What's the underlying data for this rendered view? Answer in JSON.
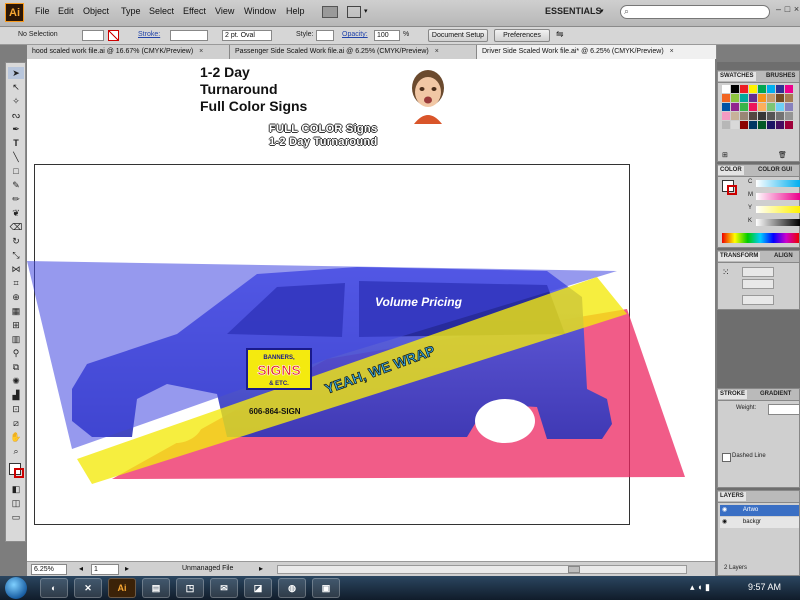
{
  "app": {
    "logo": "Ai"
  },
  "menu": {
    "items": [
      "File",
      "Edit",
      "Object",
      "Type",
      "Select",
      "Effect",
      "View",
      "Window",
      "Help"
    ],
    "workspace": "ESSENTIALS"
  },
  "controlbar": {
    "selection": "No Selection",
    "stroke_label": "Stroke:",
    "brush": "2 pt. Oval",
    "style_label": "Style:",
    "opacity_label": "Opacity:",
    "opacity_value": "100",
    "opacity_unit": "%",
    "document_setup": "Document Setup",
    "preferences": "Preferences"
  },
  "tabs": [
    {
      "label": "hood scaled work file.ai @ 16.67% (CMYK/Preview)",
      "close": "×"
    },
    {
      "label": "Passenger Side Scaled Work file.ai @ 6.25% (CMYK/Preview)",
      "close": "×"
    },
    {
      "label": "Driver Side Scaled Work file.ai* @ 6.25% (CMYK/Preview)",
      "close": "×"
    }
  ],
  "art": {
    "headline": [
      "1-2 Day",
      "Turnaround",
      "Full Color Signs"
    ],
    "outline_text": [
      "FULL COLOR Signs",
      "1-2 Day Turnaround"
    ],
    "volume": "Volume Pricing",
    "wrap": "YEAH, WE WRAP",
    "phone": "606-864-SIGN",
    "logo_lines": [
      "BANNERS,",
      "SIGNS",
      "& ETC."
    ]
  },
  "status": {
    "zoom": "6.25%",
    "page": "1",
    "mode": "Unmanaged File"
  },
  "panels": {
    "swatches": {
      "tabs": [
        "SWATCHES",
        "BRUSHES"
      ]
    },
    "color": {
      "tabs": [
        "COLOR",
        "COLOR GUI"
      ],
      "channels": [
        "C",
        "M",
        "Y",
        "K"
      ]
    },
    "transform": {
      "tabs": [
        "TRANSFORM",
        "ALIGN"
      ]
    },
    "stroke": {
      "tabs": [
        "STROKE",
        "GRADIENT"
      ],
      "weight_label": "Weight:",
      "dashed": "Dashed Line"
    },
    "layers": {
      "tab": "LAYERS",
      "rows": [
        "Artwo",
        "backgr"
      ],
      "footer": "2 Layers"
    }
  },
  "taskbar": {
    "clock": "9:57 AM",
    "ai_label": "Ai"
  },
  "colors": {
    "blue": "#3f45e0",
    "yellow": "#f4ea0f",
    "red": "#ec2560",
    "swatches": [
      "#ffffff",
      "#000000",
      "#ed1c24",
      "#fff200",
      "#00a651",
      "#00aeef",
      "#2e3192",
      "#ec008c",
      "#f26522",
      "#8dc63f",
      "#00a99d",
      "#662d91",
      "#f7941d",
      "#c69c6d",
      "#754c24",
      "#a67c52",
      "#0054a6",
      "#92278f",
      "#39b54a",
      "#ed145b",
      "#fbaf5d",
      "#7cc576",
      "#6dcff6",
      "#8781bd",
      "#f49ac2",
      "#c7b299",
      "#998675",
      "#534741",
      "#363636",
      "#555555",
      "#737373",
      "#959595",
      "#b7b7b7",
      "#d9d9d9",
      "#8b0000",
      "#003663",
      "#005826",
      "#1b1464",
      "#440e62",
      "#9e0039"
    ]
  }
}
